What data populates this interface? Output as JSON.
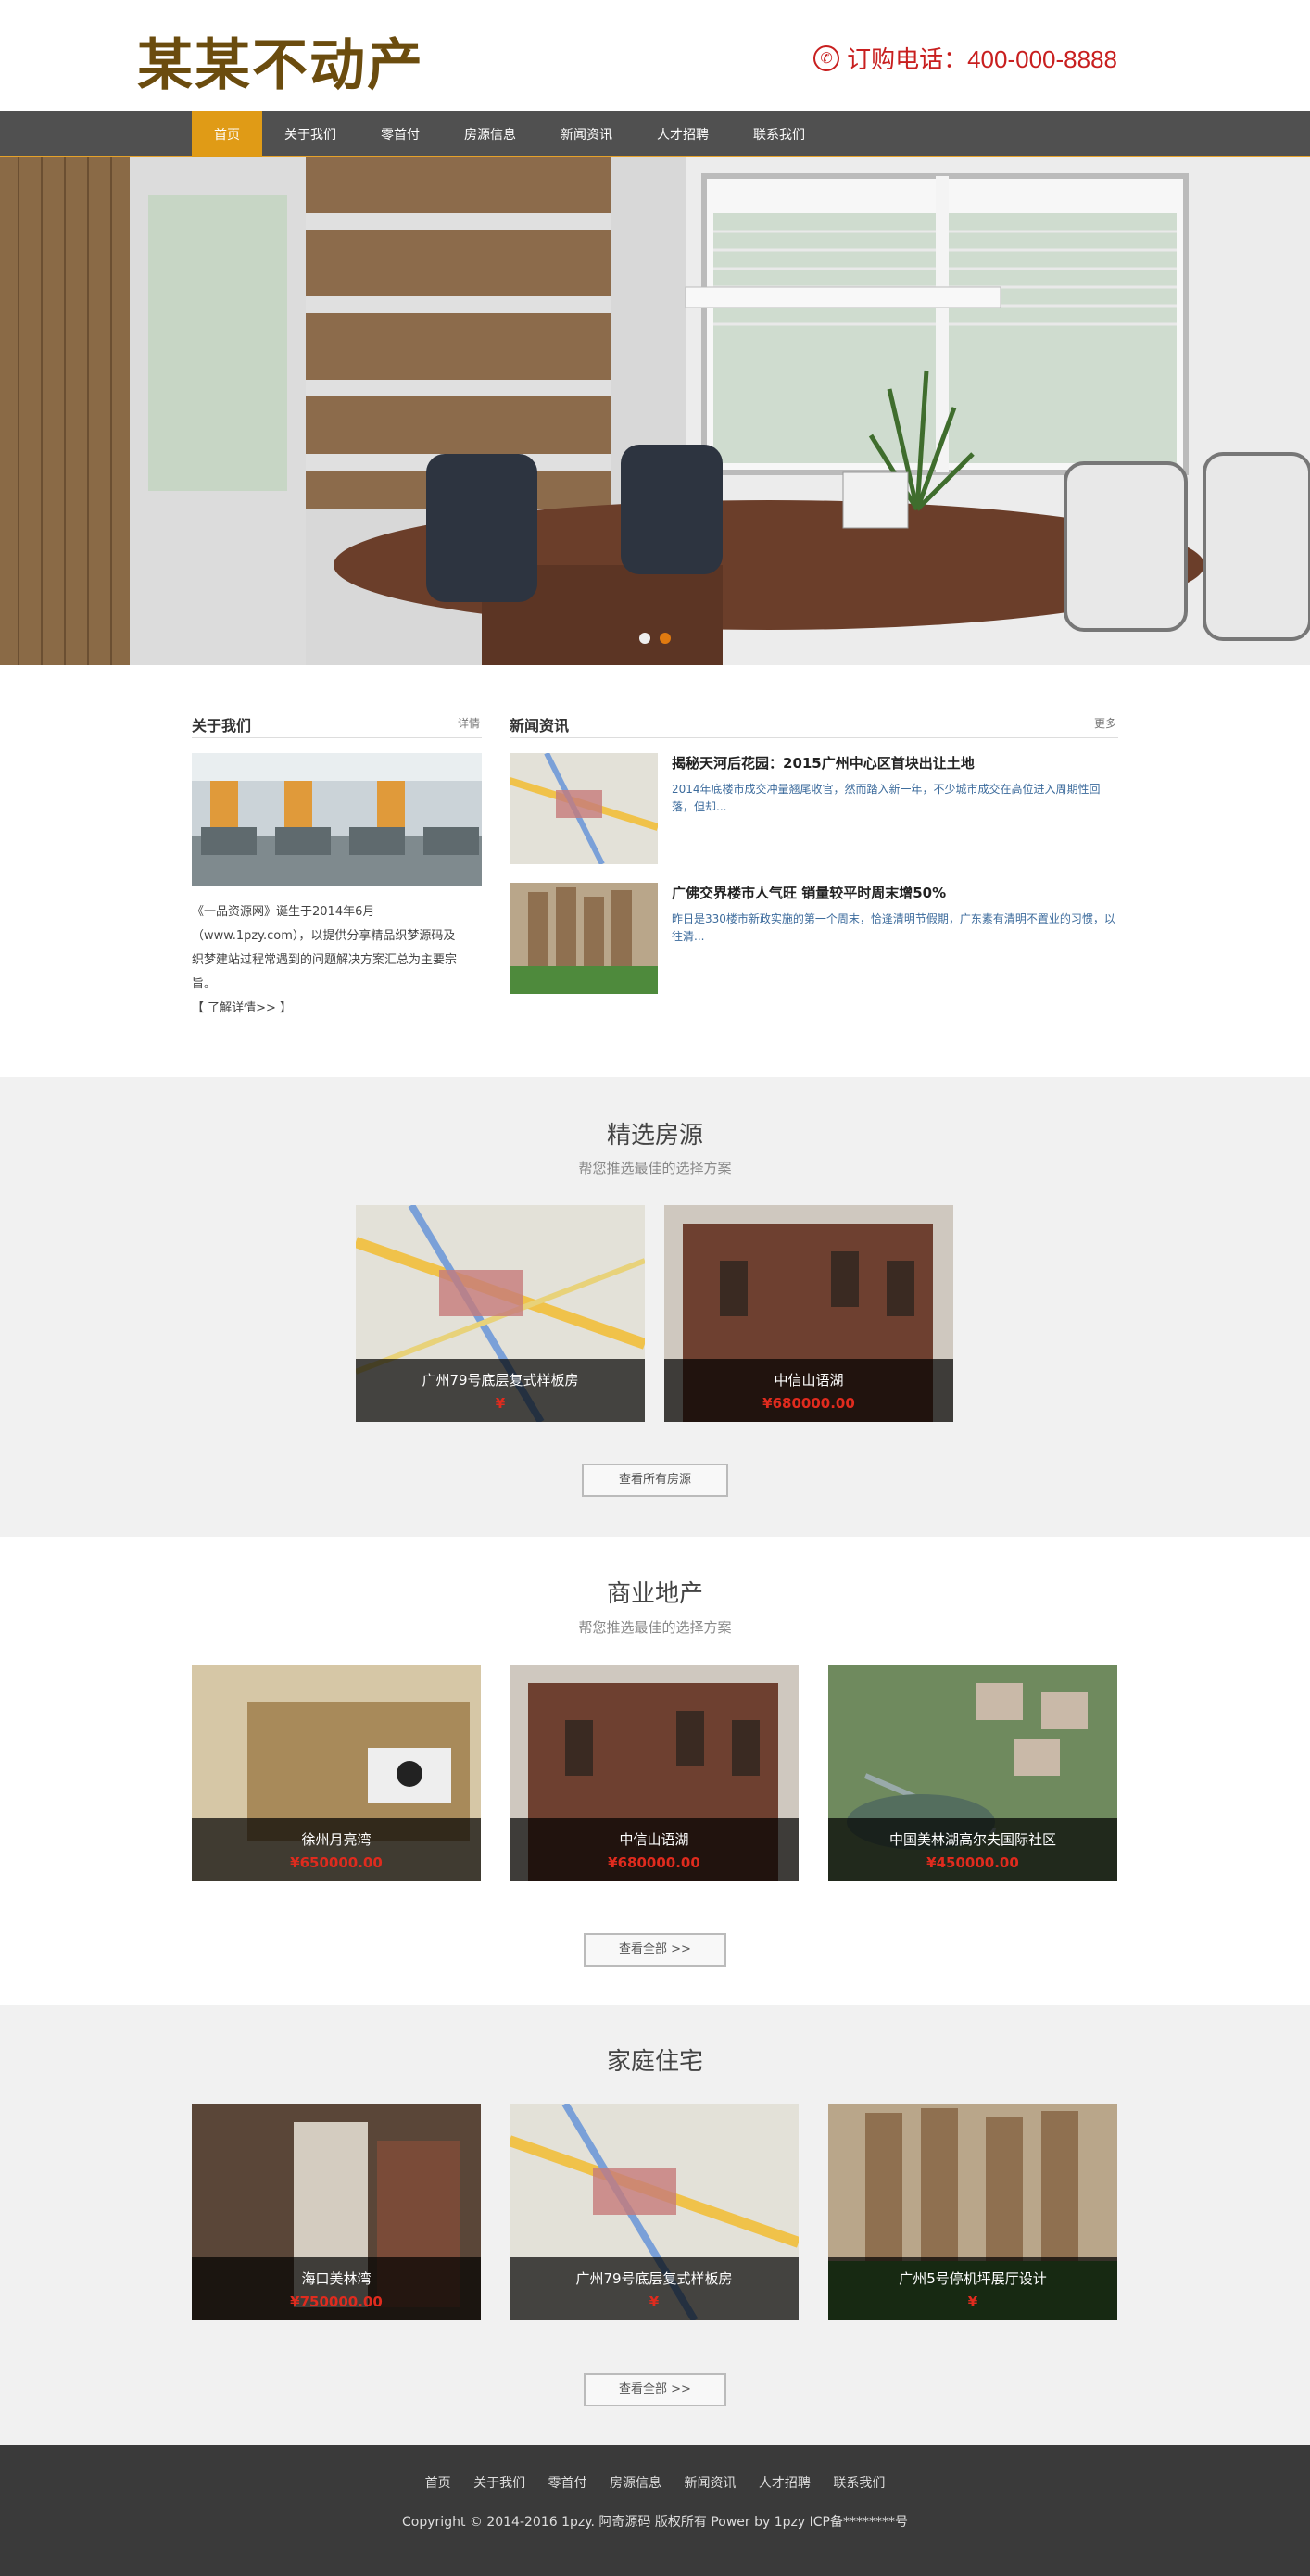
{
  "header": {
    "logo": "某某不动产",
    "phone": "订购电话：400-000-8888"
  },
  "nav": {
    "items": [
      "首页",
      "关于我们",
      "零首付",
      "房源信息",
      "新闻资讯",
      "人才招聘",
      "联系我们"
    ]
  },
  "about": {
    "title": "关于我们",
    "more": "详情",
    "text1": "《一品资源网》诞生于2014年6月",
    "text2": "（www.1pzy.com），以提供分享精品织梦源码及",
    "text3": "织梦建站过程常遇到的问题解决方案汇总为主要宗",
    "text4": "旨。",
    "link": "【 了解详情>> 】"
  },
  "news": {
    "title": "新闻资讯",
    "more": "更多",
    "items": [
      {
        "title": "揭秘天河后花园：2015广州中心区首块出让土地",
        "text1": "2014年底楼市成交冲量翘尾收官，然而踏入新一年，不少城市成交在高位进入周期性回",
        "text2": "落，但却..."
      },
      {
        "title": "广佛交界楼市人气旺 销量较平时周末增50%",
        "text1": "昨日是330楼市新政实施的第一个周末，恰逢清明节假期，广东素有清明不置业的习惯，以",
        "text2": "往清..."
      }
    ]
  },
  "featured": {
    "title": "精选房源",
    "subtitle": "帮您推选最佳的选择方案",
    "items": [
      {
        "name": "广州79号底层复式样板房",
        "price": "¥"
      },
      {
        "name": "中信山语湖",
        "price": "¥680000.00"
      }
    ],
    "button": "查看所有房源"
  },
  "commercial": {
    "title": "商业地产",
    "subtitle": "帮您推选最佳的选择方案",
    "items": [
      {
        "name": "徐州月亮湾",
        "price": "¥650000.00"
      },
      {
        "name": "中信山语湖",
        "price": "¥680000.00"
      },
      {
        "name": "中国美林湖高尔夫国际社区",
        "price": "¥450000.00"
      }
    ],
    "button": "查看全部 >>"
  },
  "residential": {
    "title": "家庭住宅",
    "items": [
      {
        "name": "海口美林湾",
        "price": "¥750000.00"
      },
      {
        "name": "广州79号底层复式样板房",
        "price": "¥"
      },
      {
        "name": "广州5号停机坪展厅设计",
        "price": "¥"
      }
    ],
    "button": "查看全部 >>"
  },
  "footer": {
    "nav": [
      "首页",
      "关于我们",
      "零首付",
      "房源信息",
      "新闻资讯",
      "人才招聘",
      "联系我们"
    ],
    "copyright": "Copyright © 2014-2016 1pzy.  阿奇源码  版权所有 Power by 1pzy ICP备********号"
  }
}
